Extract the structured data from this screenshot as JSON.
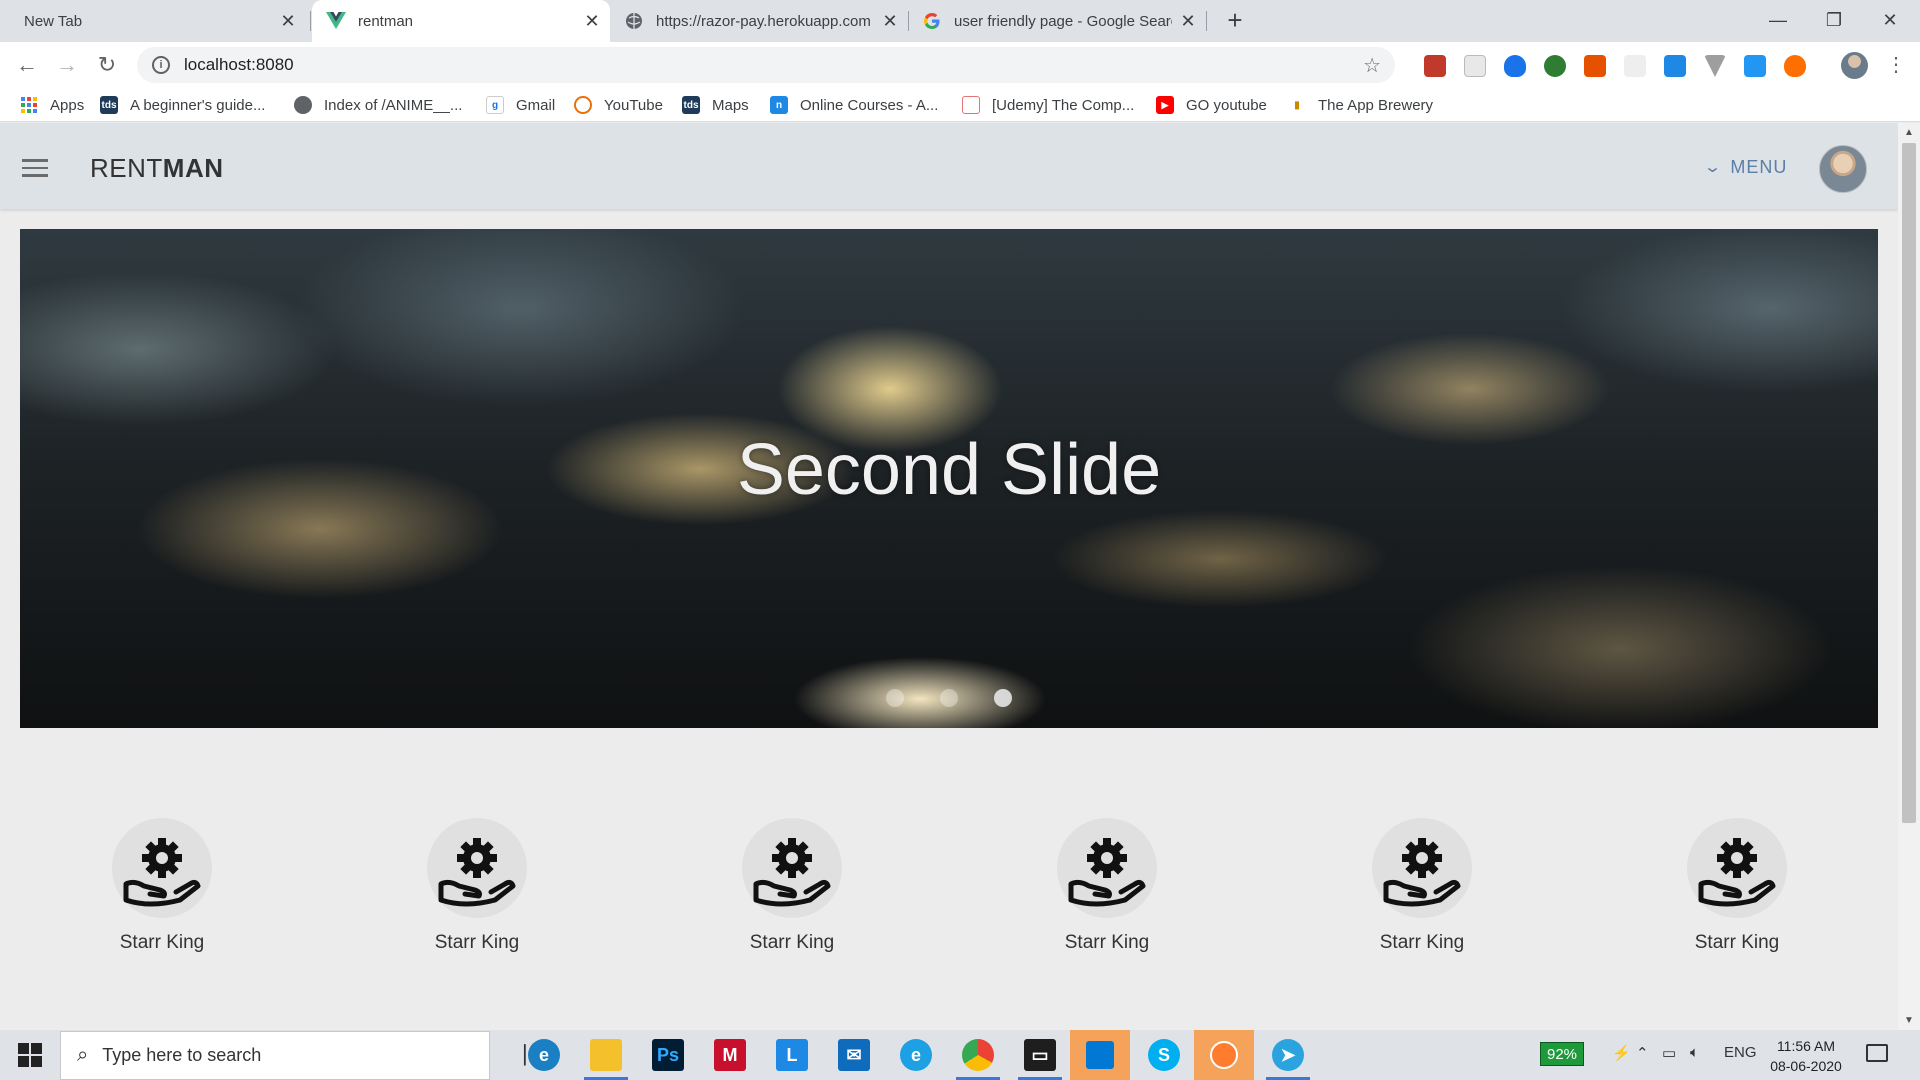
{
  "browser": {
    "tabs": [
      {
        "title": "New Tab",
        "active": false
      },
      {
        "title": "rentman",
        "active": true
      },
      {
        "title": "https://razor-pay.herokuapp.com",
        "active": false
      },
      {
        "title": "user friendly page - Google Search",
        "active": false
      }
    ],
    "url": "localhost:8080",
    "bookmarks": [
      {
        "label": "Apps",
        "icon": "apps-grid-icon"
      },
      {
        "label": "A beginner's guide...",
        "icon": "tds-icon"
      },
      {
        "label": "Index of /ANIME__...",
        "icon": "globe-icon"
      },
      {
        "label": "Gmail",
        "icon": "gmail-icon"
      },
      {
        "label": "YouTube",
        "icon": "youtube-sync-icon"
      },
      {
        "label": "Maps",
        "icon": "tds-icon"
      },
      {
        "label": "Online Courses - A...",
        "icon": "n-icon"
      },
      {
        "label": "[Udemy] The Comp...",
        "icon": "udemy-icon"
      },
      {
        "label": "GO youtube",
        "icon": "youtube-icon"
      },
      {
        "label": "The App Brewery",
        "icon": "app-brewery-icon"
      }
    ]
  },
  "app": {
    "brand_light": "RENT",
    "brand_bold": "MAN",
    "menu_label": "MENU",
    "slide_title": "Second Slide",
    "slide_count": 3,
    "active_slide_index": 2,
    "features": [
      {
        "label": "Starr King",
        "icon": "gear-hand-icon"
      },
      {
        "label": "Starr King",
        "icon": "gear-hand-icon"
      },
      {
        "label": "Starr King",
        "icon": "gear-hand-icon"
      },
      {
        "label": "Starr King",
        "icon": "gear-hand-icon"
      },
      {
        "label": "Starr King",
        "icon": "gear-hand-icon"
      },
      {
        "label": "Starr King",
        "icon": "gear-hand-icon"
      }
    ],
    "colors": {
      "menu_accent": "#5b7fa6",
      "appbar_bg": "#dde2e7"
    }
  },
  "taskbar": {
    "search_placeholder": "Type here to search",
    "battery": "92%",
    "language": "ENG",
    "time": "11:56 AM",
    "date": "08-06-2020"
  }
}
